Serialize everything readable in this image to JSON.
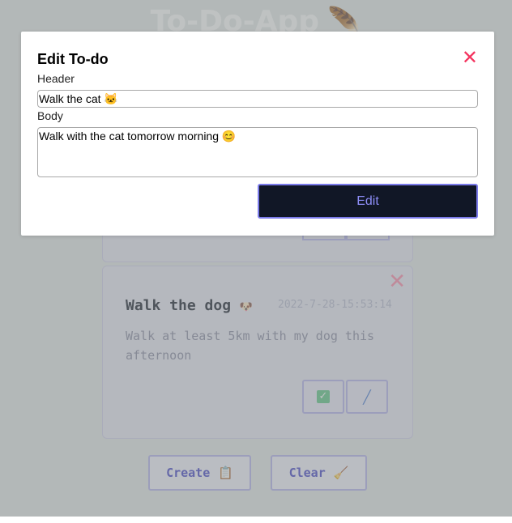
{
  "app": {
    "title": "To-Do-App",
    "title_icon": "feather-icon"
  },
  "todos": [
    {
      "title": "Walk the dog",
      "title_emoji": "🐶",
      "date": "2022-7-28-15:53:14",
      "body": "Walk at least 5km with my dog this afternoon",
      "done_icon": "checkmark-icon",
      "edit_icon": "syringe-icon"
    }
  ],
  "footer": {
    "create_label": "Create",
    "create_icon": "clipboard-icon",
    "clear_label": "Clear",
    "clear_icon": "broom-icon"
  },
  "modal": {
    "title": "Edit To-do",
    "close_icon": "close-icon",
    "header_label": "Header",
    "header_value": "Walk the cat 🐱",
    "body_label": "Body",
    "body_value": "Walk with the cat tomorrow morning 😊",
    "submit_label": "Edit"
  },
  "colors": {
    "accent": "#7b7bea",
    "close": "#f4345f",
    "edit_button_bg": "#111726"
  }
}
